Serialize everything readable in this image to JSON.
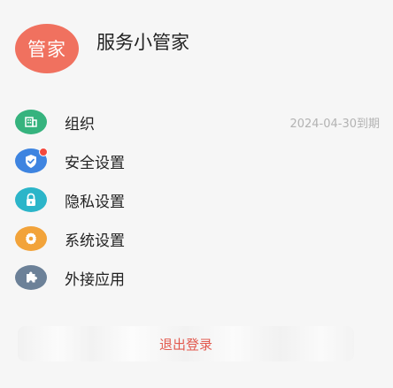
{
  "profile": {
    "avatar_text": "管家",
    "name": "服务小管家"
  },
  "menu": {
    "items": [
      {
        "label": "组织",
        "icon": "building-icon",
        "color": "#36b37e",
        "extra": "2024-04-30到期"
      },
      {
        "label": "安全设置",
        "icon": "shield-check-icon",
        "color": "#3e84e0",
        "has_notification_dot": true
      },
      {
        "label": "隐私设置",
        "icon": "lock-icon",
        "color": "#2cb5c9"
      },
      {
        "label": "系统设置",
        "icon": "gear-icon",
        "color": "#f2a33a"
      },
      {
        "label": "外接应用",
        "icon": "puzzle-icon",
        "color": "#6c8198"
      }
    ]
  },
  "logout": {
    "label": "退出登录",
    "color": "#e25a4f"
  },
  "colors": {
    "avatar_bg": "#f0715f",
    "notification_dot": "#f3483d"
  }
}
